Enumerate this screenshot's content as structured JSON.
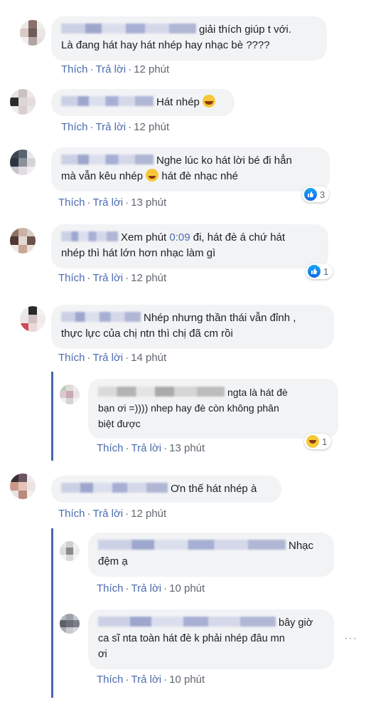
{
  "actions": {
    "like": "Thích",
    "reply": "Trả lời"
  },
  "comments": [
    {
      "line1": "giải thích giúp t với.",
      "line2": "Là đang hát hay hát nhép hay nhạc bè ????",
      "time": "12 phút"
    },
    {
      "line1": "Hát nhép",
      "time": "12 phút"
    },
    {
      "line1": "Nghe lúc ko hát lời bé đi hẳn",
      "line2a": "mà vẫn kêu nhép",
      "line2b": "hát đè nhạc nhé",
      "time": "13 phút",
      "reactions": "3"
    },
    {
      "line1a": "Xem phút ",
      "line1link": "0:09",
      "line1b": " đi, hát đè á chứ hát",
      "line2": "nhép thì hát lớn hơn nhạc làm gì",
      "time": "12 phút",
      "reactions": "1"
    },
    {
      "line1": "Nhép nhưng thần thái vẫn đỉnh ,",
      "line2": "thực lực của chị ntn thì chị đã cm rồi",
      "time": "14 phút"
    },
    {
      "line1": "ngta là hát đè",
      "line2": "bạn ơi =)))) nhep hay đè còn không phân",
      "line3": "biệt được",
      "time": "13 phút",
      "reactions": "1"
    },
    {
      "line1": "Ơn thế hát nhép à",
      "time": "12 phút"
    },
    {
      "line1": "Nhạc",
      "line2": "đệm ạ",
      "time": "10 phút"
    },
    {
      "line1": "bây giờ",
      "line2": "ca sĩ nta toàn hát đè k phải nhép đâu mn",
      "line3": "ơi",
      "time": "10 phút"
    }
  ],
  "colors": {
    "link": "#4b6bb0",
    "bubble": "#f2f3f5",
    "thread": "#4a67ad",
    "meta": "#606770"
  }
}
